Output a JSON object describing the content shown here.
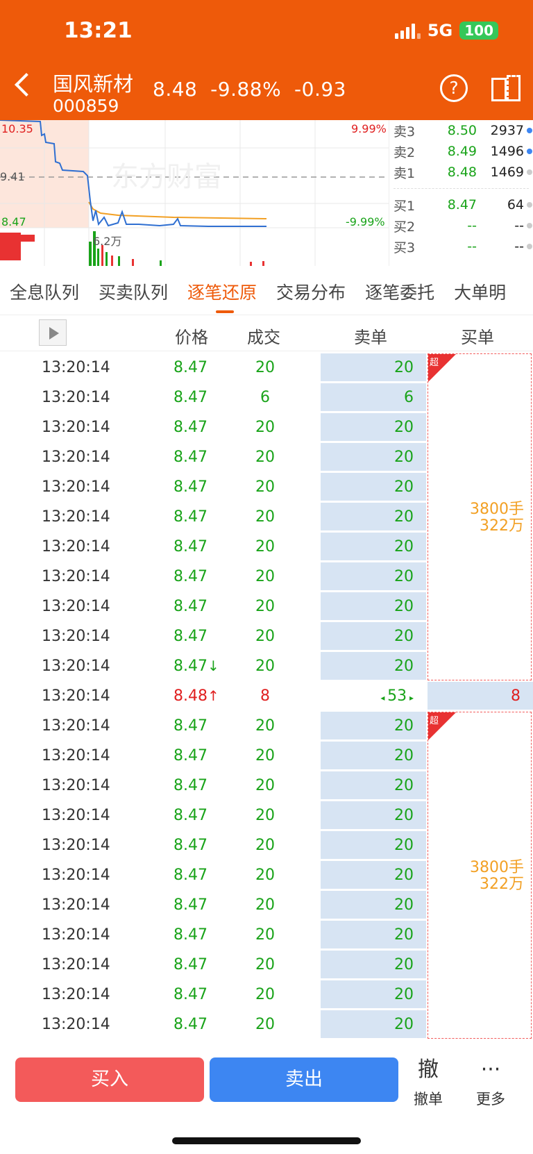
{
  "status": {
    "time": "13:21",
    "network": "5G",
    "battery": "100"
  },
  "header": {
    "stock_name": "国风新材",
    "stock_code": "000859",
    "price": "8.48",
    "change_pct": "-9.88%",
    "change": "-0.93"
  },
  "chart": {
    "high_label": "10.35",
    "mid_label": "9.41",
    "low_label": "8.47",
    "up_pct": "9.99%",
    "down_pct": "-9.99%",
    "volume_label": "6.2万",
    "watermark": "东方财富"
  },
  "depth": {
    "asks": [
      {
        "label": "卖3",
        "price": "8.50",
        "volume": "2937",
        "dot": "#3d86f2"
      },
      {
        "label": "卖2",
        "price": "8.49",
        "volume": "1496",
        "dot": "#3d86f2"
      },
      {
        "label": "卖1",
        "price": "8.48",
        "volume": "1469",
        "dot": "#cccccc"
      }
    ],
    "bids": [
      {
        "label": "买1",
        "price": "8.47",
        "volume": "64",
        "dot": "#cccccc"
      },
      {
        "label": "买2",
        "price": "--",
        "volume": "--",
        "dot": "#cccccc"
      },
      {
        "label": "买3",
        "price": "--",
        "volume": "--",
        "dot": "#cccccc"
      }
    ]
  },
  "tabs": [
    "全息队列",
    "买卖队列",
    "逐笔还原",
    "交易分布",
    "逐笔委托",
    "大单明"
  ],
  "columns": {
    "price": "价格",
    "volume": "成交",
    "sell": "卖单",
    "buy": "买单"
  },
  "rows": [
    {
      "time": "13:20:14",
      "price": "8.47",
      "vol": "20",
      "sell": "20"
    },
    {
      "time": "13:20:14",
      "price": "8.47",
      "vol": "6",
      "sell": "6"
    },
    {
      "time": "13:20:14",
      "price": "8.47",
      "vol": "20",
      "sell": "20"
    },
    {
      "time": "13:20:14",
      "price": "8.47",
      "vol": "20",
      "sell": "20"
    },
    {
      "time": "13:20:14",
      "price": "8.47",
      "vol": "20",
      "sell": "20"
    },
    {
      "time": "13:20:14",
      "price": "8.47",
      "vol": "20",
      "sell": "20"
    },
    {
      "time": "13:20:14",
      "price": "8.47",
      "vol": "20",
      "sell": "20"
    },
    {
      "time": "13:20:14",
      "price": "8.47",
      "vol": "20",
      "sell": "20"
    },
    {
      "time": "13:20:14",
      "price": "8.47",
      "vol": "20",
      "sell": "20"
    },
    {
      "time": "13:20:14",
      "price": "8.47",
      "vol": "20",
      "sell": "20"
    },
    {
      "time": "13:20:14",
      "price": "8.47",
      "vol": "20",
      "sell": "20",
      "arrow": "down"
    },
    {
      "time": "13:20:14",
      "price": "8.48",
      "vol": "8",
      "sell": "53",
      "buy": "8",
      "arrow": "up"
    },
    {
      "time": "13:20:14",
      "price": "8.47",
      "vol": "20",
      "sell": "20"
    },
    {
      "time": "13:20:14",
      "price": "8.47",
      "vol": "20",
      "sell": "20"
    },
    {
      "time": "13:20:14",
      "price": "8.47",
      "vol": "20",
      "sell": "20"
    },
    {
      "time": "13:20:14",
      "price": "8.47",
      "vol": "20",
      "sell": "20"
    },
    {
      "time": "13:20:14",
      "price": "8.47",
      "vol": "20",
      "sell": "20"
    },
    {
      "time": "13:20:14",
      "price": "8.47",
      "vol": "20",
      "sell": "20"
    },
    {
      "time": "13:20:14",
      "price": "8.47",
      "vol": "20",
      "sell": "20"
    },
    {
      "time": "13:20:14",
      "price": "8.47",
      "vol": "20",
      "sell": "20"
    },
    {
      "time": "13:20:14",
      "price": "8.47",
      "vol": "20",
      "sell": "20"
    },
    {
      "time": "13:20:14",
      "price": "8.47",
      "vol": "20",
      "sell": "20"
    },
    {
      "time": "13:20:14",
      "price": "8.47",
      "vol": "20",
      "sell": "20"
    }
  ],
  "big_orders": [
    {
      "tag": "超",
      "shares": "3800手",
      "amount": "322万"
    },
    {
      "tag": "超",
      "shares": "3800手",
      "amount": "322万"
    }
  ],
  "actions": {
    "buy": "买入",
    "sell": "卖出",
    "cancel_icon": "撤",
    "cancel": "撤单",
    "more_icon": "···",
    "more": "更多"
  },
  "colors": {
    "brand": "#ee5a0a",
    "up": "#e02020",
    "down": "#19a319",
    "sell_bg": "#d7e4f3"
  }
}
